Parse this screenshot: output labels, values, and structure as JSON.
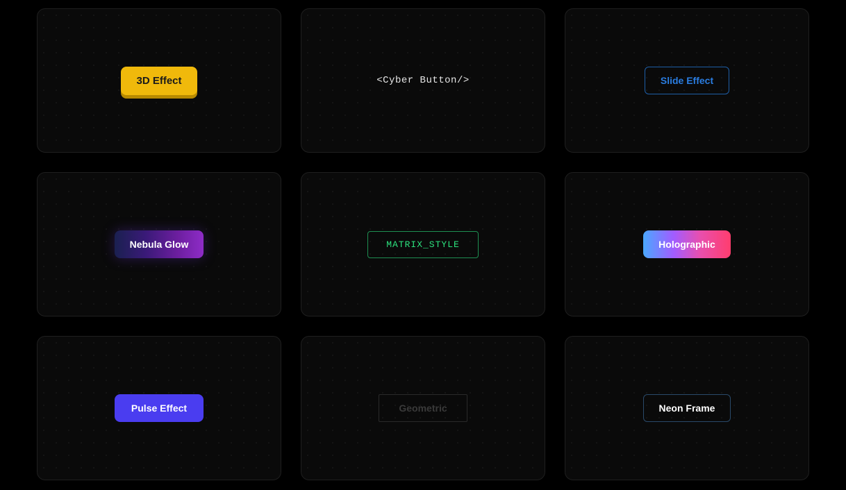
{
  "buttons": [
    {
      "label": "3D Effect",
      "variant": "3d"
    },
    {
      "label": "<Cyber Button/>",
      "variant": "cyber"
    },
    {
      "label": "Slide Effect",
      "variant": "slide"
    },
    {
      "label": "Nebula Glow",
      "variant": "nebula"
    },
    {
      "label": "MATRIX_STYLE",
      "variant": "matrix"
    },
    {
      "label": "Holographic",
      "variant": "holo"
    },
    {
      "label": "Pulse Effect",
      "variant": "pulse"
    },
    {
      "label": "Geometric",
      "variant": "geo"
    },
    {
      "label": "Neon Frame",
      "variant": "neon"
    }
  ]
}
